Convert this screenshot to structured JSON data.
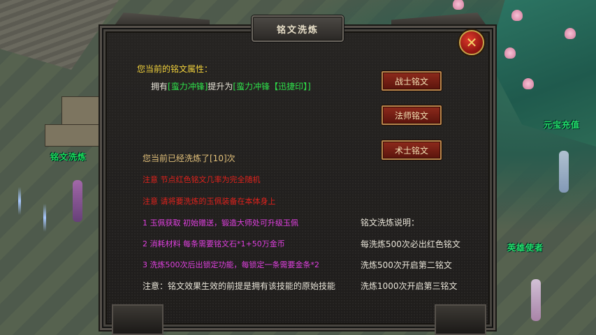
{
  "scene": {
    "npc_left": "铭文洗炼",
    "npc_right_top": "元宝充值",
    "npc_right_bottom": "英雄使者"
  },
  "dialog": {
    "title": "铭文洗炼",
    "close_icon": "close-x-icon",
    "attr_label": "您当前的铭文属性：",
    "upgrade": {
      "prefix": "拥有",
      "from": "[蛮力冲锋]",
      "middle": "提升为",
      "to": "[蛮力冲锋【迅捷印】]"
    },
    "buttons": [
      "战士铭文",
      "法师铭文",
      "术士铭文"
    ],
    "refine_count": "您当前已经洗炼了[10]次",
    "notes_red": [
      "注意 节点红色铭文几率为完全随机",
      "注意 请将要洗炼的玉佩装备在本体身上"
    ],
    "notes_magenta": [
      "1 玉佩获取 初始赠送，锻造大师处可升级玉佩",
      "2 消耗材料 每条需要铭文石*1+50万金币",
      "3 洗炼500次后出锁定功能，每锁定一条需要金条*2"
    ],
    "note_white": "注意：铭文效果生效的前提是拥有该技能的原始技能",
    "explain": [
      "铭文洗炼说明：",
      "每洗炼500次必出红色铭文",
      "洗炼500次开启第二铭文",
      "洗炼1000次开启第三铭文"
    ]
  },
  "colors": {
    "attr_label": "#f2d23c",
    "skill_green": "#2ee04a",
    "red_note": "#e0221c",
    "magenta_note": "#e040e0",
    "button_bg": "#8e2a1c"
  }
}
